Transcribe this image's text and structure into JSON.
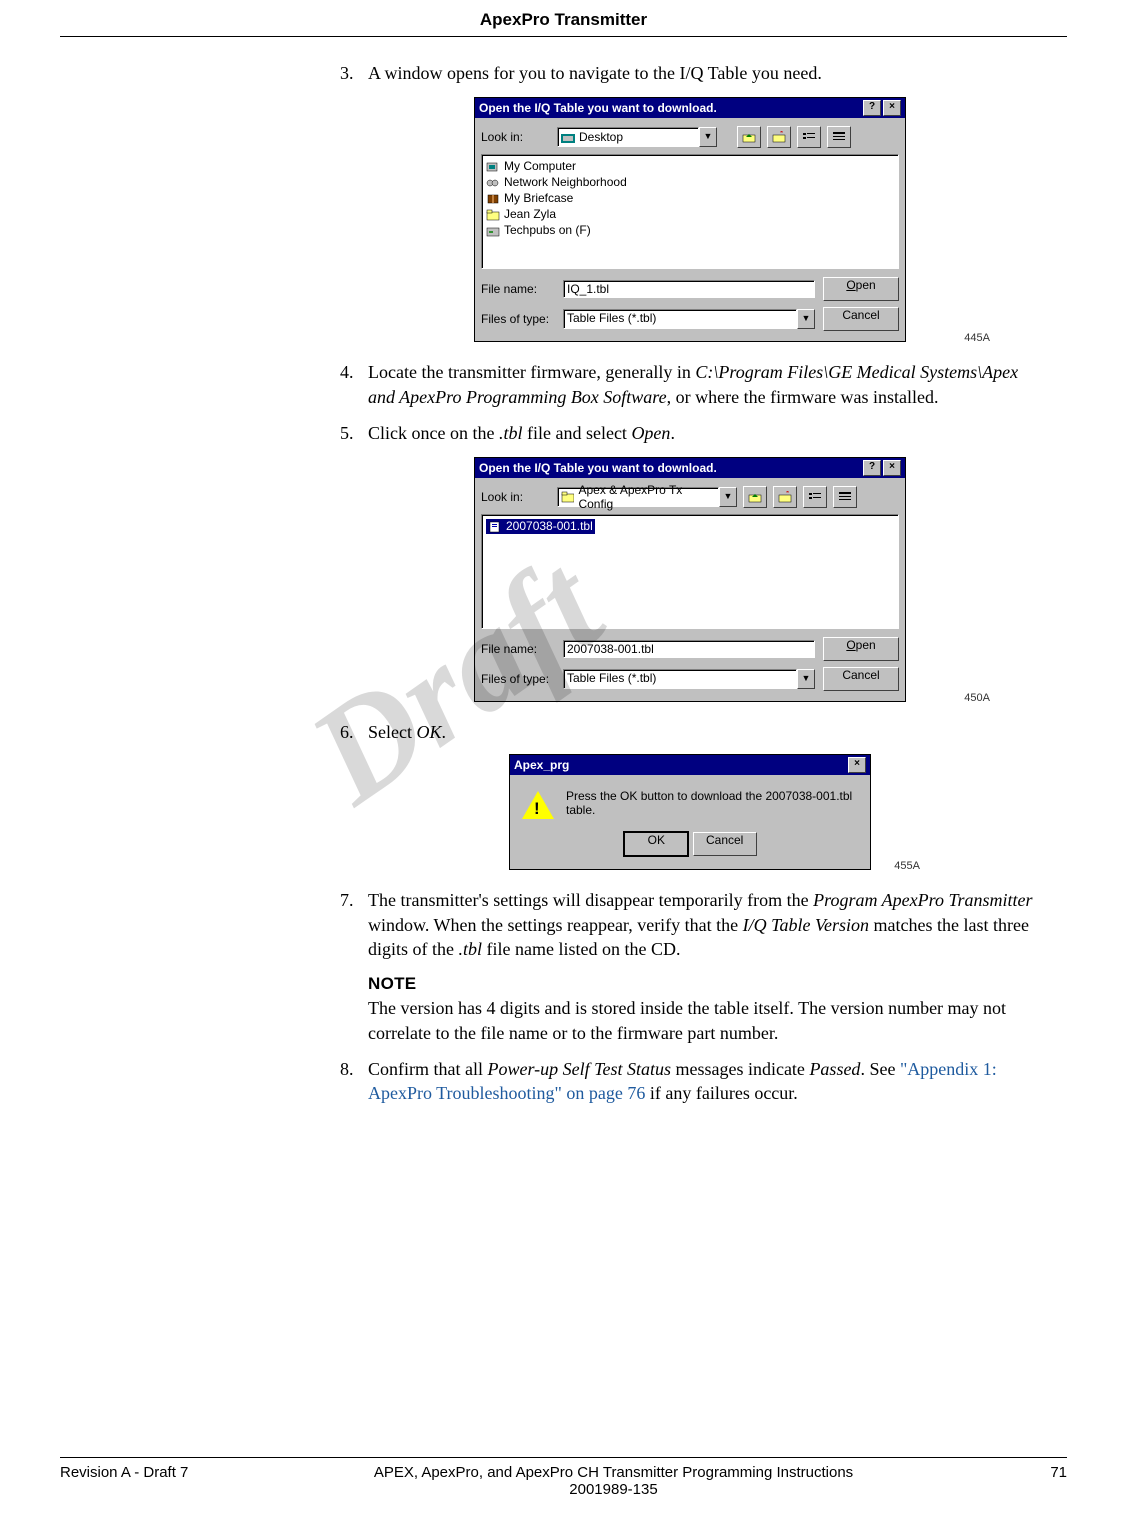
{
  "header": {
    "title": "ApexPro Transmitter"
  },
  "watermark": "Draft",
  "steps": {
    "s3": {
      "num": "3.",
      "text": "A window opens for you to navigate to the I/Q Table you need."
    },
    "s4": {
      "num": "4.",
      "pre": "Locate the transmitter firmware, generally in ",
      "path": "C:\\Program Files\\GE Medical Systems\\Apex and ApexPro Programming Box Software",
      "post": ", or where the firmware was installed."
    },
    "s5": {
      "num": "5.",
      "pre": "Click once on the ",
      "ext": ".tbl",
      "mid": " file and select ",
      "open": "Open",
      "post": "."
    },
    "s6": {
      "num": "6.",
      "pre": "Select ",
      "ok": "OK",
      "post": "."
    },
    "s7": {
      "num": "7.",
      "t1": "The transmitter's settings will disappear temporarily from the ",
      "i1": "Program ApexPro Transmitter",
      "t2": " window. When the settings reappear, verify that the ",
      "i2": "I/Q Table Version",
      "t3": " matches the last three digits of the ",
      "i3": ".tbl",
      "t4": " file name listed on the CD."
    },
    "note": {
      "heading": "NOTE",
      "body": "The version has 4 digits and is stored inside the table itself. The version number may not correlate to the file name or to the firmware part number."
    },
    "s8": {
      "num": "8.",
      "t1": "Confirm that all ",
      "i1": "Power-up Self Test Status",
      "t2": " messages indicate ",
      "i2": "Passed",
      "t3": ". See ",
      "link": "\"Appendix 1: ApexPro Troubleshooting\" on page 76",
      "t4": " if any failures occur."
    }
  },
  "dlg1": {
    "title": "Open the I/Q Table you want to download.",
    "lookin_lbl": "Look in:",
    "lookin_val": "Desktop",
    "items": [
      "My Computer",
      "Network Neighborhood",
      "My Briefcase",
      "Jean Zyla",
      "Techpubs on (F)"
    ],
    "filename_lbl": "File name:",
    "filename_val": "IQ_1.tbl",
    "filetype_lbl": "Files of type:",
    "filetype_val": "Table Files (*.tbl)",
    "open": "Open",
    "cancel": "Cancel",
    "figref": "445A"
  },
  "dlg2": {
    "title": "Open the I/Q Table you want to download.",
    "lookin_lbl": "Look in:",
    "lookin_val": "Apex & ApexPro Tx Config",
    "items": [
      "2007038-001.tbl"
    ],
    "filename_lbl": "File name:",
    "filename_val": "2007038-001.tbl",
    "filetype_lbl": "Files of type:",
    "filetype_val": "Table Files (*.tbl)",
    "open": "Open",
    "cancel": "Cancel",
    "figref": "450A"
  },
  "dlg3": {
    "title": "Apex_prg",
    "msg": "Press the OK button to download the 2007038-001.tbl table.",
    "ok": "OK",
    "cancel": "Cancel",
    "figref": "455A"
  },
  "footer": {
    "left": "Revision A - Draft 7",
    "center1": "APEX, ApexPro, and ApexPro CH Transmitter Programming Instructions",
    "center2": "2001989-135",
    "right": "71"
  }
}
